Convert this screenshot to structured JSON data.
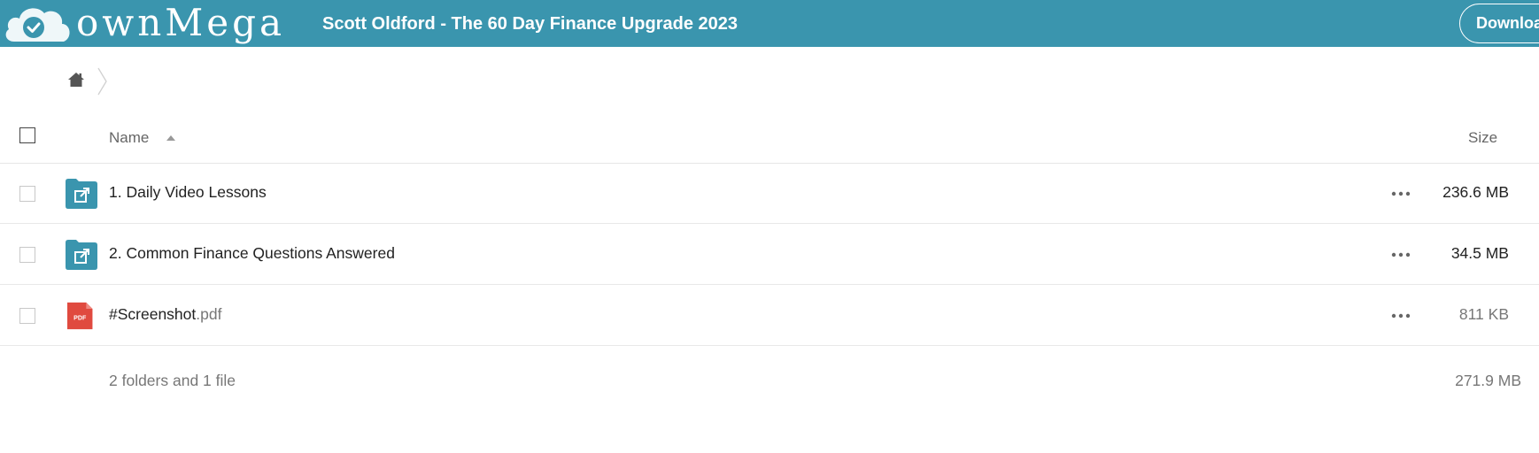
{
  "header": {
    "logo_text": "ownMega",
    "title": "Scott Oldford - The 60 Day Finance Upgrade 2023",
    "download_label": "Download",
    "brand_color": "#3a95ae"
  },
  "breadcrumb": {
    "home_icon": "home-icon",
    "separator_icon": "chevron-right-icon"
  },
  "table": {
    "columns": {
      "name": "Name",
      "size": "Size",
      "sort_direction": "ascending"
    },
    "rows": [
      {
        "icon": "shared-folder-icon",
        "name": "1. Daily Video Lessons",
        "ext": "",
        "size": "236.6 MB"
      },
      {
        "icon": "shared-folder-icon",
        "name": "2. Common Finance Questions Answered",
        "ext": "",
        "size": "34.5 MB"
      },
      {
        "icon": "pdf-file-icon",
        "icon_label": "PDF",
        "name": "#Screenshot",
        "ext": ".pdf",
        "size": "811 KB"
      }
    ]
  },
  "summary": {
    "text": "2 folders and 1 file",
    "total_size": "271.9 MB"
  },
  "colors": {
    "folder": "#3a95ae",
    "pdf": "#e04a3f"
  }
}
